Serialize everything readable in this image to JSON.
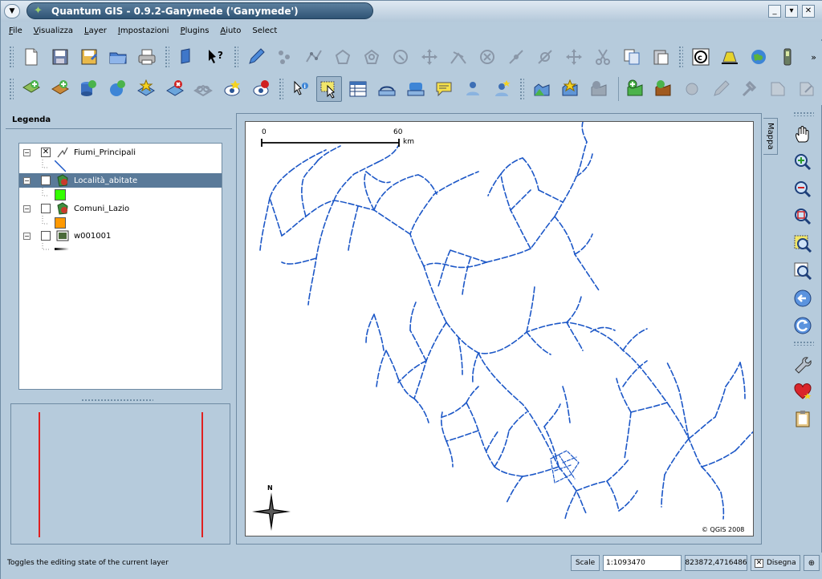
{
  "window": {
    "title": "Quantum GIS - 0.9.2-Ganymede ('Ganymede')",
    "menu_glyph": "▼",
    "controls": {
      "minimize": "_",
      "maximize": "▾",
      "close": "✕"
    },
    "app_icon_glyph": "✦"
  },
  "menubar": {
    "items": [
      {
        "label": "File",
        "underline": "F",
        "rest": "ile"
      },
      {
        "label": "Visualizza",
        "underline": "V",
        "rest": "isualizza"
      },
      {
        "label": "Layer",
        "underline": "L",
        "rest": "ayer"
      },
      {
        "label": "Impostazioni",
        "underline": "I",
        "rest": "mpostazioni"
      },
      {
        "label": "Plugins",
        "underline": "P",
        "rest": "lugins"
      },
      {
        "label": "Aiuto",
        "underline": "A",
        "rest": "iuto"
      },
      {
        "label": "Select",
        "underline": "",
        "rest": "Select"
      }
    ]
  },
  "toolbar1": {
    "more_glyph": "»"
  },
  "legend": {
    "tab_label": "Legenda",
    "layers": [
      {
        "name": "Fiumi_Principali",
        "checked": "✕",
        "expander": "⊟"
      },
      {
        "name": "Località_abitate",
        "checked": "",
        "expander": "⊟"
      },
      {
        "name": "Comuni_Lazio",
        "checked": "",
        "expander": "⊟"
      },
      {
        "name": "w001001",
        "checked": "",
        "expander": "⊟"
      }
    ],
    "swatch_colors": {
      "localita": "#33ff00",
      "comuni": "#ff9900"
    }
  },
  "map": {
    "tab_label": "Mappa",
    "scalebar": {
      "start": "0",
      "end": "60",
      "unit": "km"
    },
    "north_label": "N",
    "copyright": "© QGIS 2008",
    "river_color": "#1c57c7"
  },
  "statusbar": {
    "message": "Toggles the editing state of the current layer",
    "scale_label": "Scale",
    "scale_value": "1:1093470",
    "coordinates": "823872,4716486",
    "render_label": "Disegna",
    "render_checked": "✕",
    "projection_glyph": "⊕"
  }
}
